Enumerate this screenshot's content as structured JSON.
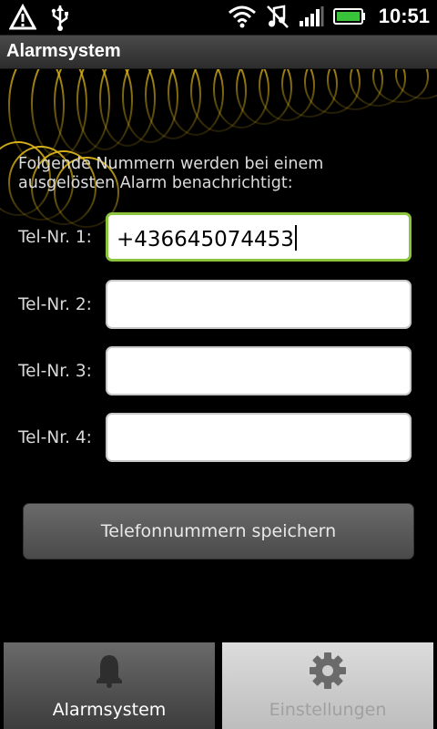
{
  "status_bar": {
    "time": "10:51",
    "icons": [
      "warning-icon",
      "usb-icon",
      "wifi-icon",
      "music-muted-icon",
      "signal-icon",
      "battery-icon"
    ]
  },
  "app": {
    "title": "Alarmsystem"
  },
  "intro_text": "Folgende Nummern werden bei einem ausgelösten Alarm benachrichtigt:",
  "phone_fields": [
    {
      "label": "Tel-Nr. 1:",
      "value": "+436645074453",
      "focused": true
    },
    {
      "label": "Tel-Nr. 2:",
      "value": ""
    },
    {
      "label": "Tel-Nr. 3:",
      "value": ""
    },
    {
      "label": "Tel-Nr. 4:",
      "value": ""
    }
  ],
  "save_button": {
    "label": "Telefonnummern speichern"
  },
  "tabs": [
    {
      "label": "Alarmsystem",
      "icon": "bell-icon",
      "selected": true
    },
    {
      "label": "Einstellungen",
      "icon": "gear-icon",
      "selected": false
    }
  ],
  "colors": {
    "focus_border": "#8bc53f",
    "art_accent": "#e0b81a"
  }
}
